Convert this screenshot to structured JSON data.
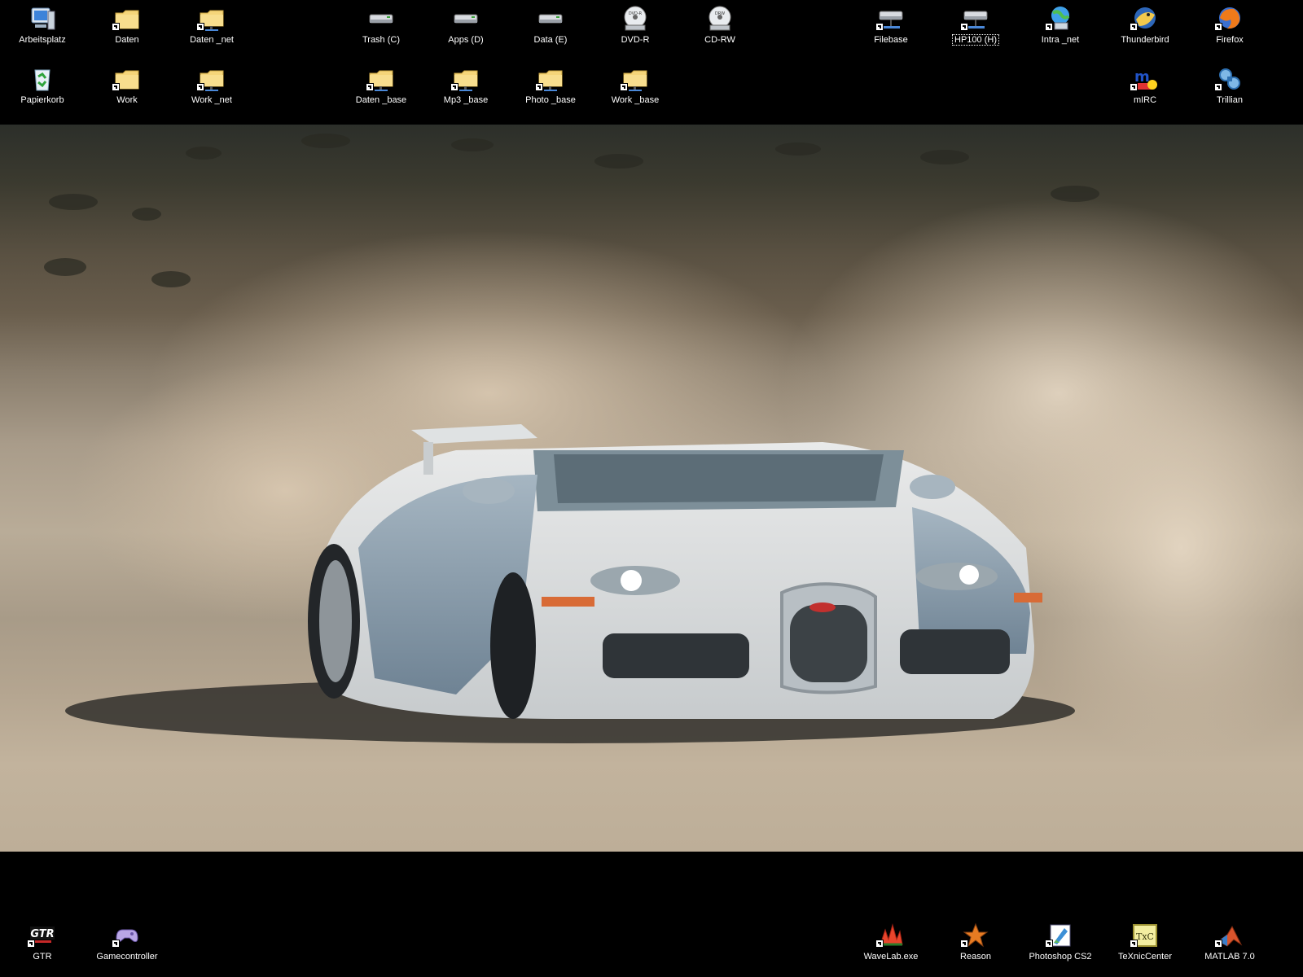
{
  "desktop": {
    "background": "#000000",
    "label_color": "#ffffff",
    "top_left_icons": [
      {
        "label": "Arbeitsplatz",
        "icon": "my-computer-icon"
      },
      {
        "label": "Daten",
        "icon": "folder-shortcut-icon"
      },
      {
        "label": "Daten _net",
        "icon": "network-folder-icon"
      },
      {
        "label": "Papierkorb",
        "icon": "recycle-bin-icon"
      },
      {
        "label": "Work",
        "icon": "folder-shortcut-icon"
      },
      {
        "label": "Work _net",
        "icon": "network-folder-icon"
      }
    ],
    "top_middle_icons": [
      {
        "label": "Trash (C)",
        "icon": "drive-icon"
      },
      {
        "label": "Apps (D)",
        "icon": "drive-icon"
      },
      {
        "label": "Data (E)",
        "icon": "drive-icon"
      },
      {
        "label": "DVD-R",
        "icon": "dvd-drive-icon"
      },
      {
        "label": "CD-RW",
        "icon": "cd-drive-icon"
      },
      {
        "label": "Daten _base",
        "icon": "network-folder-icon"
      },
      {
        "label": "Mp3 _base",
        "icon": "network-folder-icon"
      },
      {
        "label": "Photo _base",
        "icon": "network-folder-icon"
      },
      {
        "label": "Work _base",
        "icon": "network-folder-icon"
      }
    ],
    "top_right_icons": [
      {
        "label": "Filebase",
        "icon": "network-drive-icon"
      },
      {
        "label": "HP100 (H)",
        "icon": "network-drive-icon",
        "selected": true
      },
      {
        "label": "Intra _net",
        "icon": "network-places-icon"
      },
      {
        "label": "Thunderbird",
        "icon": "thunderbird-icon"
      },
      {
        "label": "Firefox",
        "icon": "firefox-icon"
      },
      {
        "label": "mIRC",
        "icon": "mirc-icon"
      },
      {
        "label": "Trillian",
        "icon": "trillian-icon"
      }
    ],
    "bottom_left_icons": [
      {
        "label": "GTR",
        "icon": "gtr-game-icon"
      },
      {
        "label": "Gamecontroller",
        "icon": "gamecontroller-icon"
      }
    ],
    "bottom_right_icons": [
      {
        "label": "WaveLab.exe",
        "icon": "wavelab-icon"
      },
      {
        "label": "Reason",
        "icon": "reason-icon"
      },
      {
        "label": "Photoshop CS2",
        "icon": "photoshop-icon"
      },
      {
        "label": "TeXnicCenter",
        "icon": "texniccenter-icon"
      },
      {
        "label": "MATLAB 7.0",
        "icon": "matlab-icon"
      }
    ]
  },
  "wallpaper": {
    "subject": "bugatti-car-icon"
  }
}
